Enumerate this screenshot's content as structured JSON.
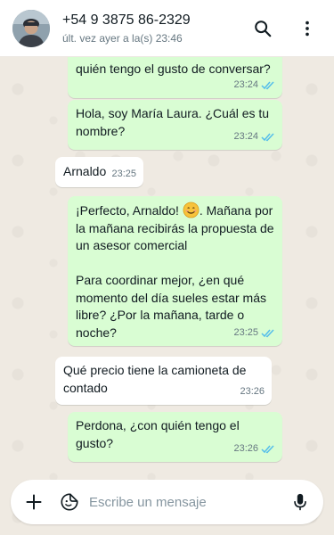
{
  "header": {
    "contact_name": "+54 9 3875 86-2329",
    "last_seen": "últ. vez ayer a la(s) 23:46",
    "search_icon": "search-icon",
    "menu_icon": "more-vert-icon"
  },
  "messages": [
    {
      "direction": "out",
      "text": "quién tengo el gusto de conversar?",
      "time": "23:24",
      "read": true
    },
    {
      "direction": "out",
      "text": "Hola, soy María Laura. ¿Cuál es tu\nnombre?",
      "time": "23:24",
      "read": true
    },
    {
      "direction": "in",
      "text": "Arnaldo",
      "time": "23:25"
    },
    {
      "direction": "out",
      "text_before_emoji": "¡Perfecto, Arnaldo! ",
      "emoji": "smiling-face",
      "text_after_emoji": ". Mañana por\nla mañana recibirás la propuesta de\nun asesor comercial\n\nPara coordinar mejor, ¿en qué\nmomento del día sueles estar más\nlibre? ¿Por la mañana, tarde o\nnoche?",
      "time": "23:25",
      "read": true
    },
    {
      "direction": "in",
      "text": "Qué precio tiene la camioneta de\ncontado",
      "time": "23:26"
    },
    {
      "direction": "out",
      "text": "Perdona, ¿con quién tengo el\ngusto?",
      "time": "23:26",
      "read": true
    }
  ],
  "composer": {
    "placeholder": "Escribe un mensaje",
    "attach_icon": "plus-icon",
    "sticker_icon": "sticker-icon",
    "mic_icon": "mic-icon"
  },
  "colors": {
    "outgoing_bubble": "#d9fdd3",
    "incoming_bubble": "#ffffff",
    "read_ticks": "#53bdeb",
    "wallpaper": "#efeae2"
  }
}
